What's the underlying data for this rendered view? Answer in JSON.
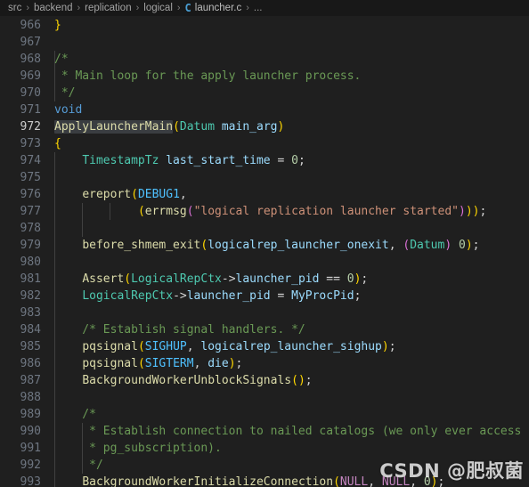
{
  "breadcrumb": {
    "segments": [
      "src",
      "backend",
      "replication",
      "logical"
    ],
    "separator": "›",
    "file_icon": "C",
    "file_icon_name": "c-file-icon",
    "file": "launcher.c",
    "ellipsis": "..."
  },
  "editor": {
    "language": "c",
    "first_line_number": 966,
    "active_line": 972,
    "selection_text": "ApplyLauncherMain",
    "lines": [
      {
        "n": 966,
        "text": "}"
      },
      {
        "n": 967,
        "text": ""
      },
      {
        "n": 968,
        "text": "/*"
      },
      {
        "n": 969,
        "text": " * Main loop for the apply launcher process."
      },
      {
        "n": 970,
        "text": " */"
      },
      {
        "n": 971,
        "text": "void"
      },
      {
        "n": 972,
        "text": "ApplyLauncherMain(Datum main_arg)"
      },
      {
        "n": 973,
        "text": "{"
      },
      {
        "n": 974,
        "text": "    TimestampTz last_start_time = 0;"
      },
      {
        "n": 975,
        "text": ""
      },
      {
        "n": 976,
        "text": "    ereport(DEBUG1,"
      },
      {
        "n": 977,
        "text": "            (errmsg(\"logical replication launcher started\")));"
      },
      {
        "n": 978,
        "text": ""
      },
      {
        "n": 979,
        "text": "    before_shmem_exit(logicalrep_launcher_onexit, (Datum) 0);"
      },
      {
        "n": 980,
        "text": ""
      },
      {
        "n": 981,
        "text": "    Assert(LogicalRepCtx->launcher_pid == 0);"
      },
      {
        "n": 982,
        "text": "    LogicalRepCtx->launcher_pid = MyProcPid;"
      },
      {
        "n": 983,
        "text": ""
      },
      {
        "n": 984,
        "text": "    /* Establish signal handlers. */"
      },
      {
        "n": 985,
        "text": "    pqsignal(SIGHUP, logicalrep_launcher_sighup);"
      },
      {
        "n": 986,
        "text": "    pqsignal(SIGTERM, die);"
      },
      {
        "n": 987,
        "text": "    BackgroundWorkerUnblockSignals();"
      },
      {
        "n": 988,
        "text": ""
      },
      {
        "n": 989,
        "text": "    /*"
      },
      {
        "n": 990,
        "text": "     * Establish connection to nailed catalogs (we only ever access"
      },
      {
        "n": 991,
        "text": "     * pg_subscription)."
      },
      {
        "n": 992,
        "text": "     */"
      },
      {
        "n": 993,
        "text": "    BackgroundWorkerInitializeConnection(NULL, NULL, 0);"
      }
    ]
  },
  "watermark": {
    "text": "CSDN @肥叔菌"
  },
  "colors": {
    "background": "#1f1f1f",
    "breadcrumb_background": "#181818",
    "line_number": "#6e7681",
    "line_number_active": "#cccccc",
    "comment": "#6a9955",
    "keyword": "#569cd6",
    "type": "#4ec9b0",
    "function": "#dcdcaa",
    "variable": "#9cdcfe",
    "string": "#ce9178",
    "number": "#b5cea8",
    "constant": "#4fc1ff",
    "macro": "#c586c0",
    "selection": "#3a3d41",
    "indent_guide": "#404040",
    "c_icon": "#4a9fd4"
  }
}
